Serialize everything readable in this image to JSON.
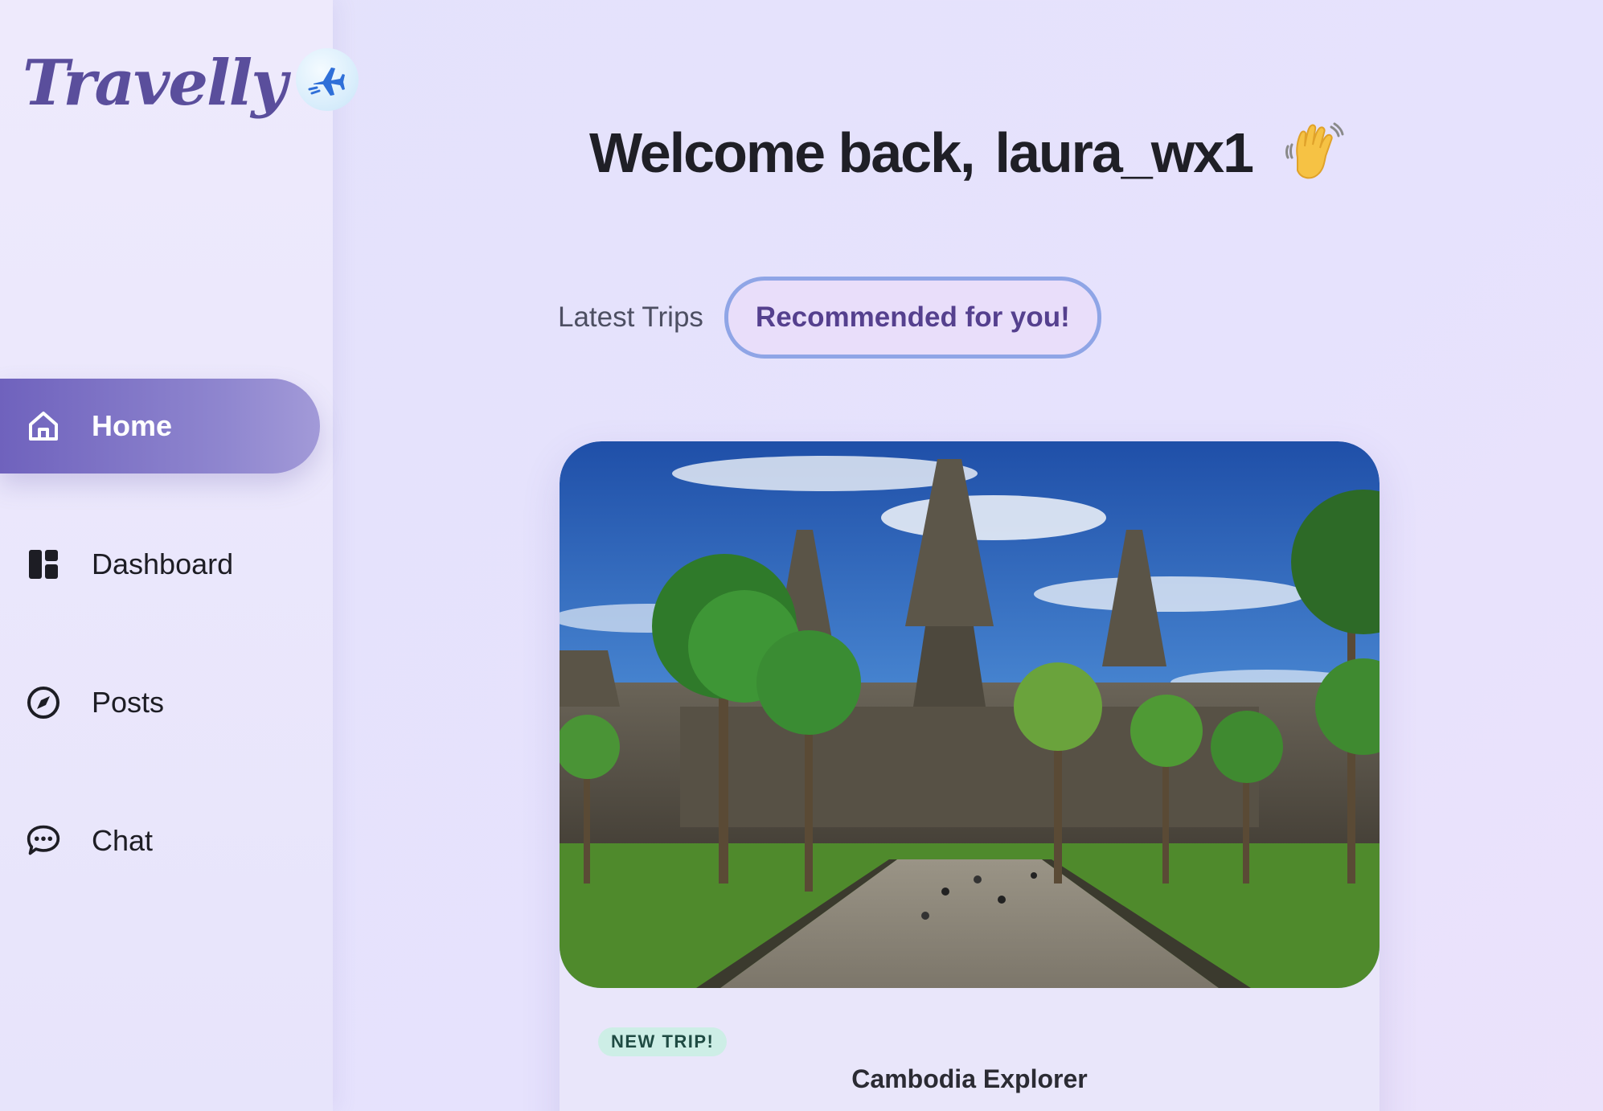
{
  "brand": {
    "name": "Travelly",
    "badge_icon": "airplane-icon"
  },
  "sidebar": {
    "items": [
      {
        "label": "Home",
        "icon": "home-icon",
        "active": true
      },
      {
        "label": "Dashboard",
        "icon": "dashboard-icon",
        "active": false
      },
      {
        "label": "Posts",
        "icon": "compass-icon",
        "active": false
      },
      {
        "label": "Chat",
        "icon": "chat-bubble-icon",
        "active": false
      }
    ]
  },
  "header": {
    "greeting": "Welcome back,",
    "username": "laura_wx1",
    "emoji": "waving-hand-icon"
  },
  "tabs": [
    {
      "label": "Latest Trips",
      "active": false
    },
    {
      "label": "Recommended for you!",
      "active": true
    }
  ],
  "trip_card": {
    "badge": "NEW TRIP!",
    "title": "Cambodia Explorer",
    "image": "angkor-wat-temple-photo"
  },
  "colors": {
    "accent": "#6f62bd",
    "brand_text": "#5a4e9c",
    "tab_active_border": "#8fa5e6",
    "badge_bg": "#cdeee6"
  }
}
